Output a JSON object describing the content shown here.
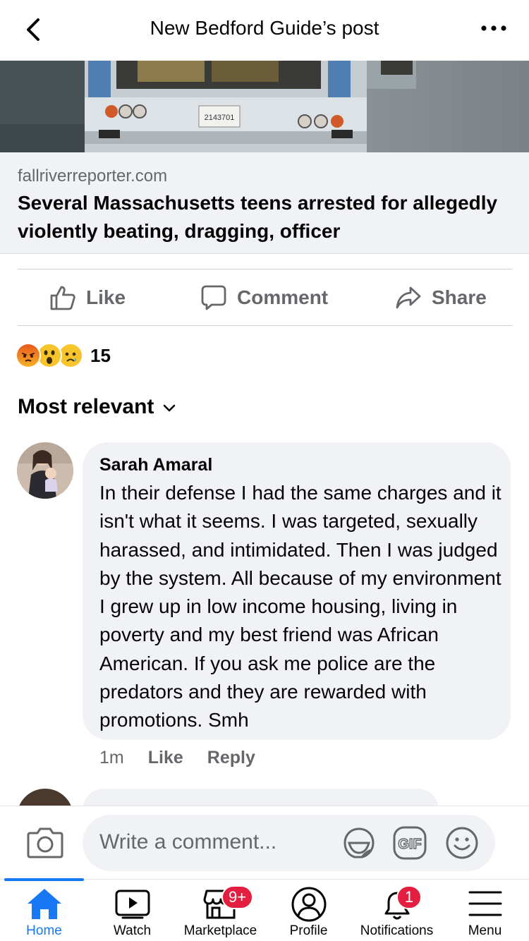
{
  "header": {
    "title": "New Bedford Guide’s post"
  },
  "hero": {
    "plate_text": "2143701"
  },
  "link_card": {
    "domain": "fallriverreporter.com",
    "headline": "Several Massachusetts teens arrested for allegedly violently beating, dragging, officer"
  },
  "actions": {
    "like": "Like",
    "comment": "Comment",
    "share": "Share"
  },
  "reactions": {
    "icons": [
      "angry-emoji",
      "wow-emoji",
      "sad-emoji"
    ],
    "count": "15"
  },
  "comments_sort": {
    "label": "Most relevant"
  },
  "comment": {
    "author": "Sarah Amaral",
    "text": "In their defense I had the same charges and it isn't what it seems. I was targeted, sexually harassed, and intimidated. Then I was judged by the system. All because of my environment  I grew up in low income housing, living in poverty and my best friend was African American. If you ask me police are the predators and they are rewarded with promotions. Smh",
    "time": "1m",
    "like": "Like",
    "reply": "Reply"
  },
  "composer": {
    "placeholder": "Write a comment..."
  },
  "tabbar": {
    "items": [
      {
        "label": "Home",
        "active": true
      },
      {
        "label": "Watch"
      },
      {
        "label": "Marketplace",
        "badge": "9+"
      },
      {
        "label": "Profile"
      },
      {
        "label": "Notifications",
        "badge": "1"
      },
      {
        "label": "Menu"
      }
    ]
  },
  "colors": {
    "accent": "#1877f2",
    "badge": "#e41e3f",
    "bubble": "#f0f2f5",
    "secondary_text": "#65676b"
  }
}
